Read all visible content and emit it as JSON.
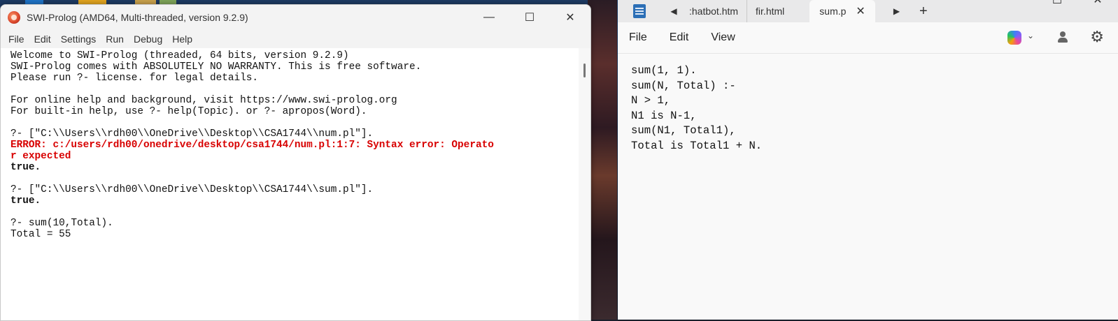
{
  "colors": {
    "error_text": "#d80000",
    "console_background": "#ffffff",
    "editor_background": "#f9f9f9",
    "tabstrip_background": "#e9e9ea"
  },
  "prolog": {
    "window_title": "SWI-Prolog (AMD64, Multi-threaded, version 9.2.9)",
    "title_icon": "swi-prolog-owl-icon",
    "window_controls": {
      "minimize": "—",
      "maximize": "☐",
      "close": "✕"
    },
    "menu": [
      "File",
      "Edit",
      "Settings",
      "Run",
      "Debug",
      "Help"
    ],
    "console_lines": [
      {
        "text": "Welcome to SWI-Prolog (threaded, 64 bits, version 9.2.9)",
        "style": "normal"
      },
      {
        "text": "SWI-Prolog comes with ABSOLUTELY NO WARRANTY. This is free software.",
        "style": "normal"
      },
      {
        "text": "Please run ?- license. for legal details.",
        "style": "normal"
      },
      {
        "text": "",
        "style": "normal"
      },
      {
        "text": "For online help and background, visit https://www.swi-prolog.org",
        "style": "normal"
      },
      {
        "text": "For built-in help, use ?- help(Topic). or ?- apropos(Word).",
        "style": "normal"
      },
      {
        "text": "",
        "style": "normal"
      },
      {
        "text": "?- [\"C:\\\\Users\\\\rdh00\\\\OneDrive\\\\Desktop\\\\CSA1744\\\\num.pl\"].",
        "style": "normal"
      },
      {
        "text": "ERROR: c:/users/rdh00/onedrive/desktop/csa1744/num.pl:1:7: Syntax error: Operato",
        "style": "error"
      },
      {
        "text": "r expected",
        "style": "error"
      },
      {
        "text": "true.",
        "style": "bold"
      },
      {
        "text": "",
        "style": "normal"
      },
      {
        "text": "?- [\"C:\\\\Users\\\\rdh00\\\\OneDrive\\\\Desktop\\\\CSA1744\\\\sum.pl\"].",
        "style": "normal"
      },
      {
        "text": "true.",
        "style": "bold"
      },
      {
        "text": "",
        "style": "normal"
      },
      {
        "text": "?- sum(10,Total).",
        "style": "normal"
      },
      {
        "text": "Total = 55",
        "style": "normal"
      }
    ]
  },
  "notepad": {
    "app_icon": "notepad-icon",
    "tabs": [
      {
        "label": ":hatbot.htm",
        "active": false
      },
      {
        "label": "fir.html",
        "active": false
      },
      {
        "label": "sum.p",
        "active": true
      }
    ],
    "tab_controls": {
      "scroll_left": "◀",
      "scroll_right": "▶",
      "close": "✕",
      "add": "+"
    },
    "window_controls": {
      "minimize": "—",
      "maximize": "☐",
      "close": "✕"
    },
    "menu": [
      "File",
      "Edit",
      "View"
    ],
    "toolbar_icons": [
      "copilot-icon",
      "chevron-down-icon",
      "profile-icon",
      "settings-icon"
    ],
    "editor_lines": [
      "sum(1, 1).",
      "sum(N, Total) :-",
      "N > 1,",
      "N1 is N-1,",
      "sum(N1, Total1),",
      "Total is Total1 + N."
    ]
  }
}
